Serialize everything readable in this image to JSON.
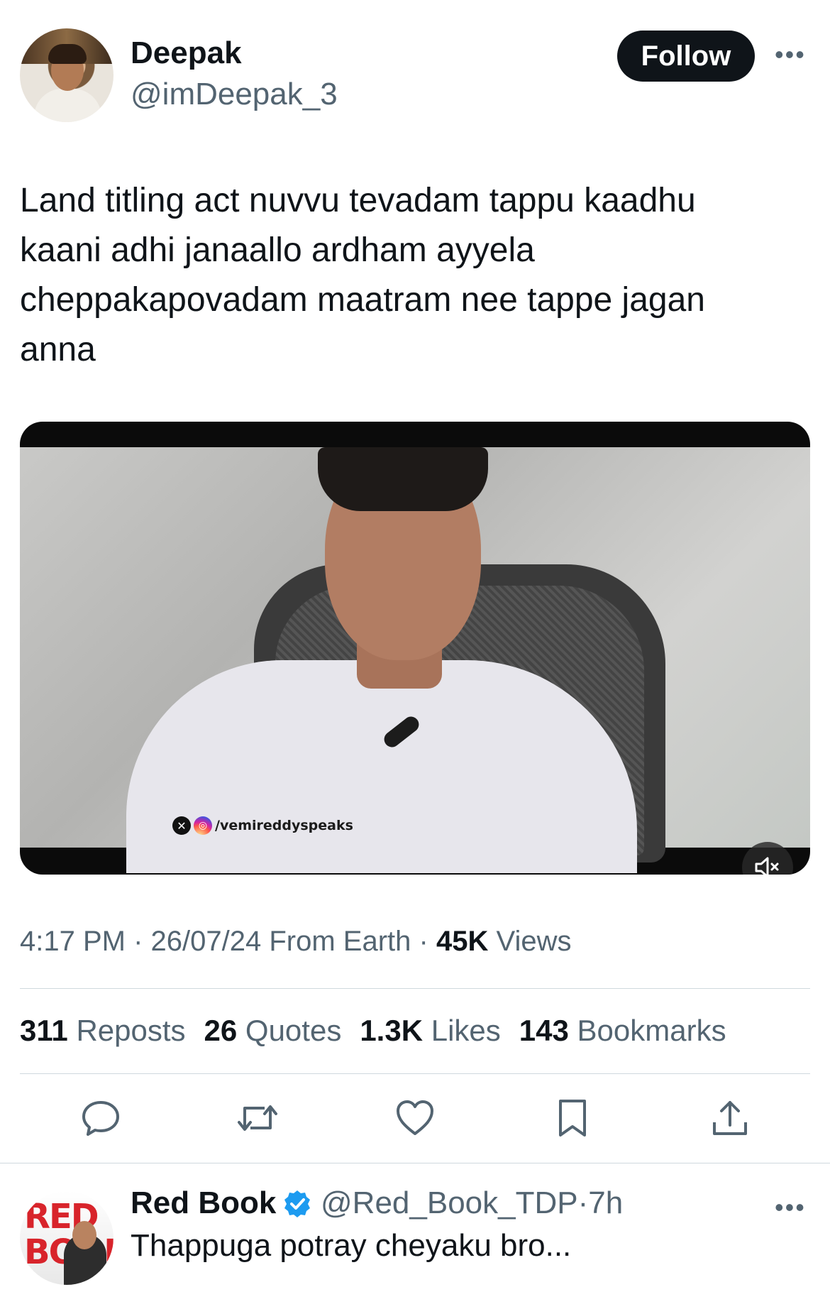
{
  "tweet": {
    "author_name": "Deepak",
    "author_handle": "@imDeepak_3",
    "follow_label": "Follow",
    "more_label": "•••",
    "text": "Land titling act nuvvu tevadam tappu kaadhu\nkaani adhi janaallo ardham ayyela\ncheppakapovadam maatram nee tappe jagan\nanna",
    "video": {
      "watermark": "/vemireddyspeaks",
      "watermark_x_icon": "x-logo-icon",
      "watermark_ig_icon": "instagram-icon",
      "mute_icon": "speaker-muted-icon"
    },
    "time": "4:17 PM",
    "date": "26/07/24",
    "source": "From Earth",
    "views_count": "45K",
    "views_label": "Views",
    "sep": "·"
  },
  "stats": {
    "reposts_count": "311",
    "reposts_label": "Reposts",
    "quotes_count": "26",
    "quotes_label": "Quotes",
    "likes_count": "1.3K",
    "likes_label": "Likes",
    "bookmarks_count": "143",
    "bookmarks_label": "Bookmarks"
  },
  "actions": {
    "icons": [
      "reply-icon",
      "repost-icon",
      "like-icon",
      "bookmark-icon",
      "share-icon"
    ],
    "color": "#536471"
  },
  "reply": {
    "author_name": "Red Book",
    "verified_icon": "verified-badge-icon",
    "verified_color": "#1d9bf0",
    "author_handle": "@Red_Book_TDP",
    "time": "7h",
    "sep": "·",
    "text": "Thappuga potray cheyaku bro...",
    "more_label": "•••",
    "avatar_text_line1": "RED",
    "avatar_text_line2": "BOOK"
  }
}
